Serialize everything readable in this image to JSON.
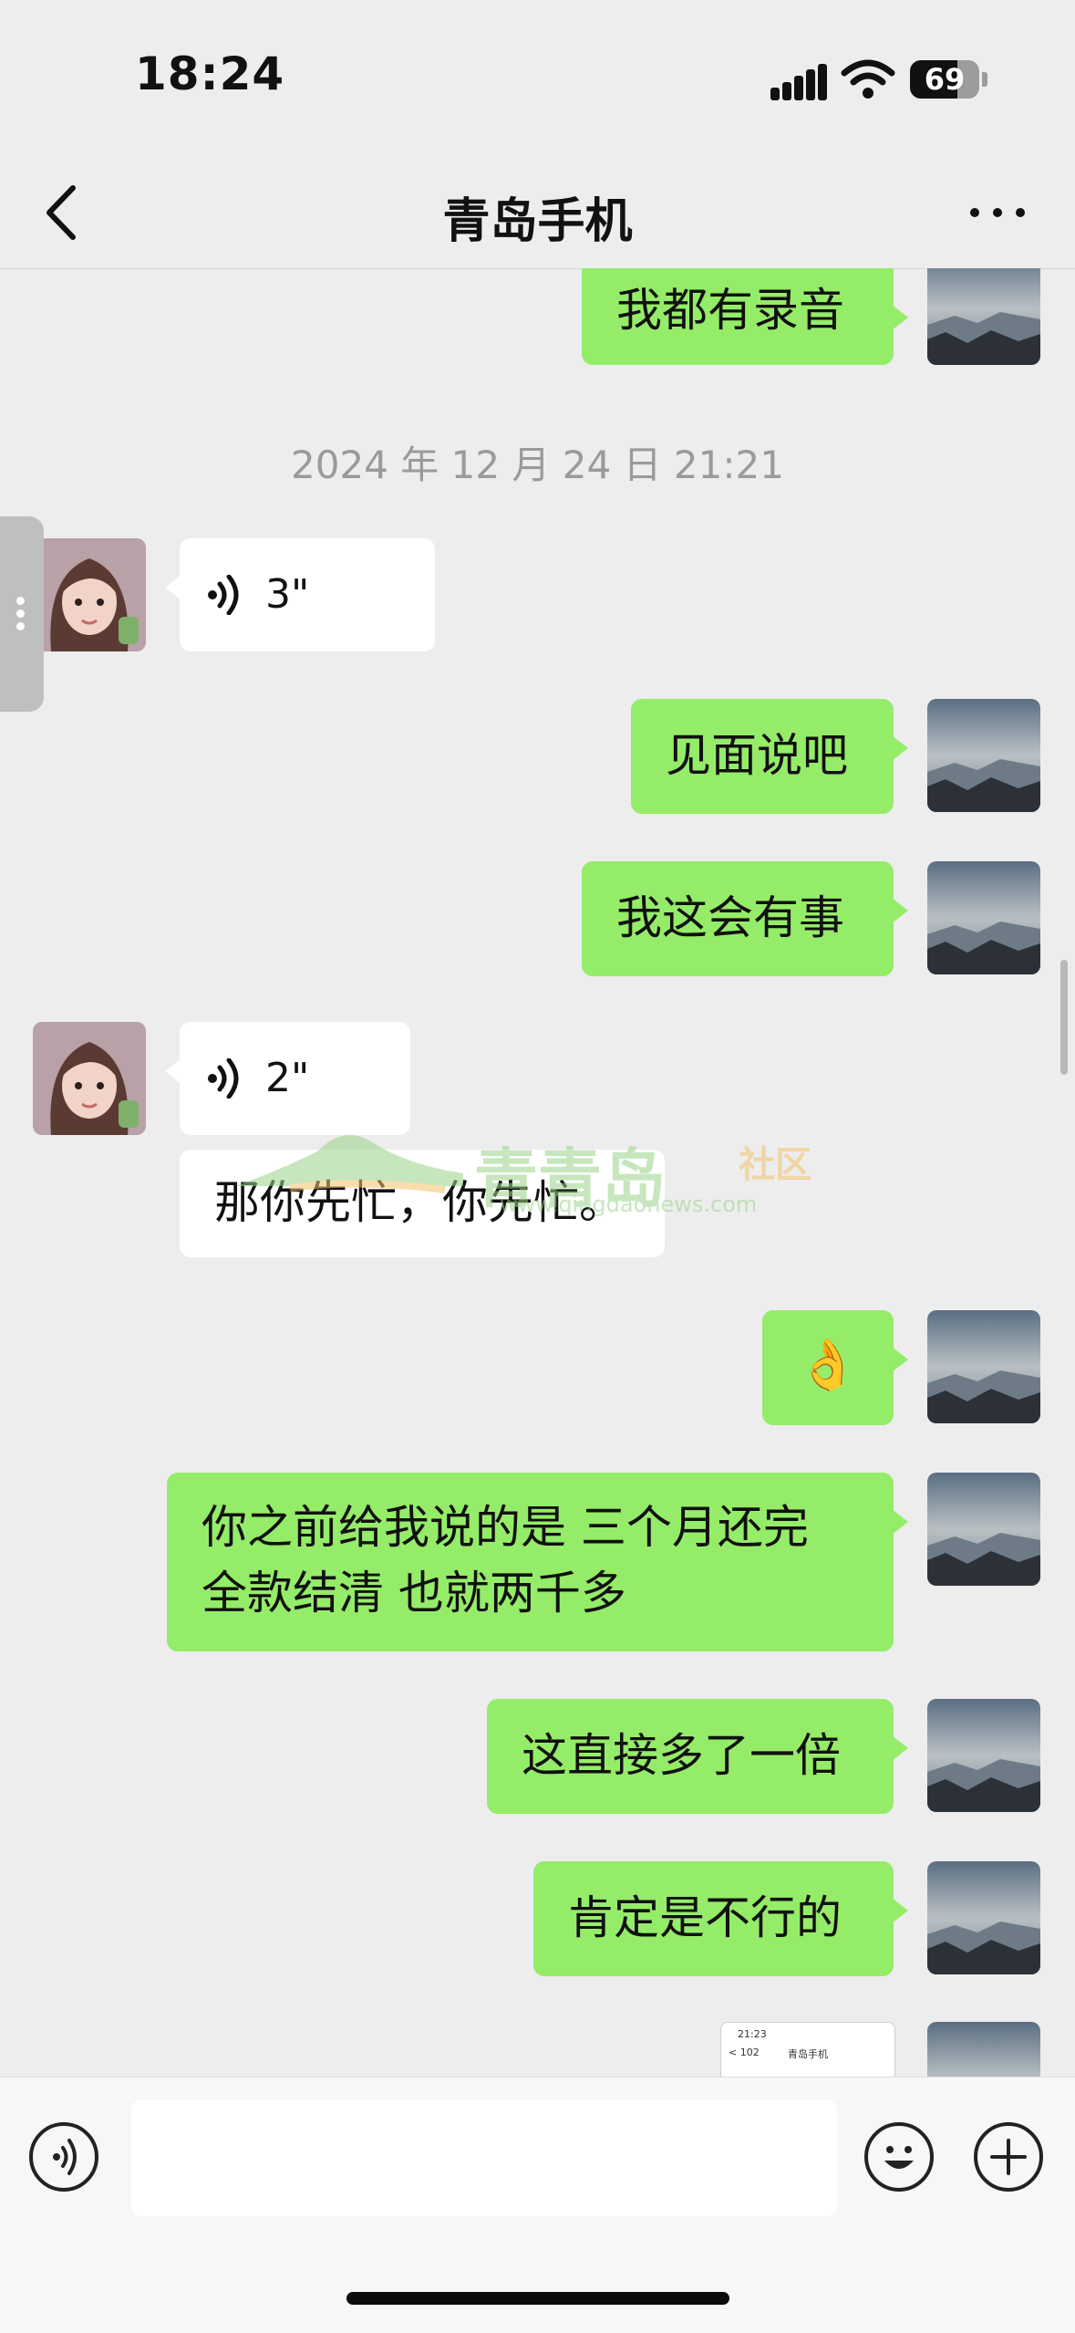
{
  "status_bar": {
    "time": "18:24",
    "battery": "69",
    "battery_level": 0.69
  },
  "header": {
    "title": "青岛手机",
    "back_icon": "chevron-left-icon",
    "more_icon": "ellipsis-icon"
  },
  "chat": {
    "timestamp": "2024 年 12 月 24 日 21:21",
    "messages": [
      {
        "sender": "me",
        "type": "text",
        "text": "我都有录音"
      },
      {
        "sender": "them",
        "type": "voice",
        "duration": "3\""
      },
      {
        "sender": "me",
        "type": "text",
        "text": "见面说吧"
      },
      {
        "sender": "me",
        "type": "text",
        "text": "我这会有事"
      },
      {
        "sender": "them",
        "type": "voice",
        "duration": "2\""
      },
      {
        "sender": "them",
        "type": "text",
        "text": "那你先忙，你先忙。"
      },
      {
        "sender": "me",
        "type": "emoji",
        "text": "👌"
      },
      {
        "sender": "me",
        "type": "text",
        "text": "你之前给我说的是 三个月还完\n全款结清 也就两千多"
      },
      {
        "sender": "me",
        "type": "text",
        "text": "这直接多了一倍"
      },
      {
        "sender": "me",
        "type": "text",
        "text": "肯定是不行的"
      },
      {
        "sender": "me",
        "type": "image",
        "preview_time": "21:23",
        "preview_title": "青岛手机",
        "preview_back": "< 102"
      }
    ]
  },
  "watermark": {
    "brand": "青青岛",
    "community": "社区",
    "url": "www.qingdaonews.com"
  },
  "input_bar": {
    "voice_icon": "voice-input-icon",
    "emoji_icon": "emoji-icon",
    "add_icon": "plus-icon",
    "placeholder": ""
  },
  "colors": {
    "my_bubble": "#95ec69",
    "their_bubble": "#ffffff",
    "background": "#ededed"
  }
}
